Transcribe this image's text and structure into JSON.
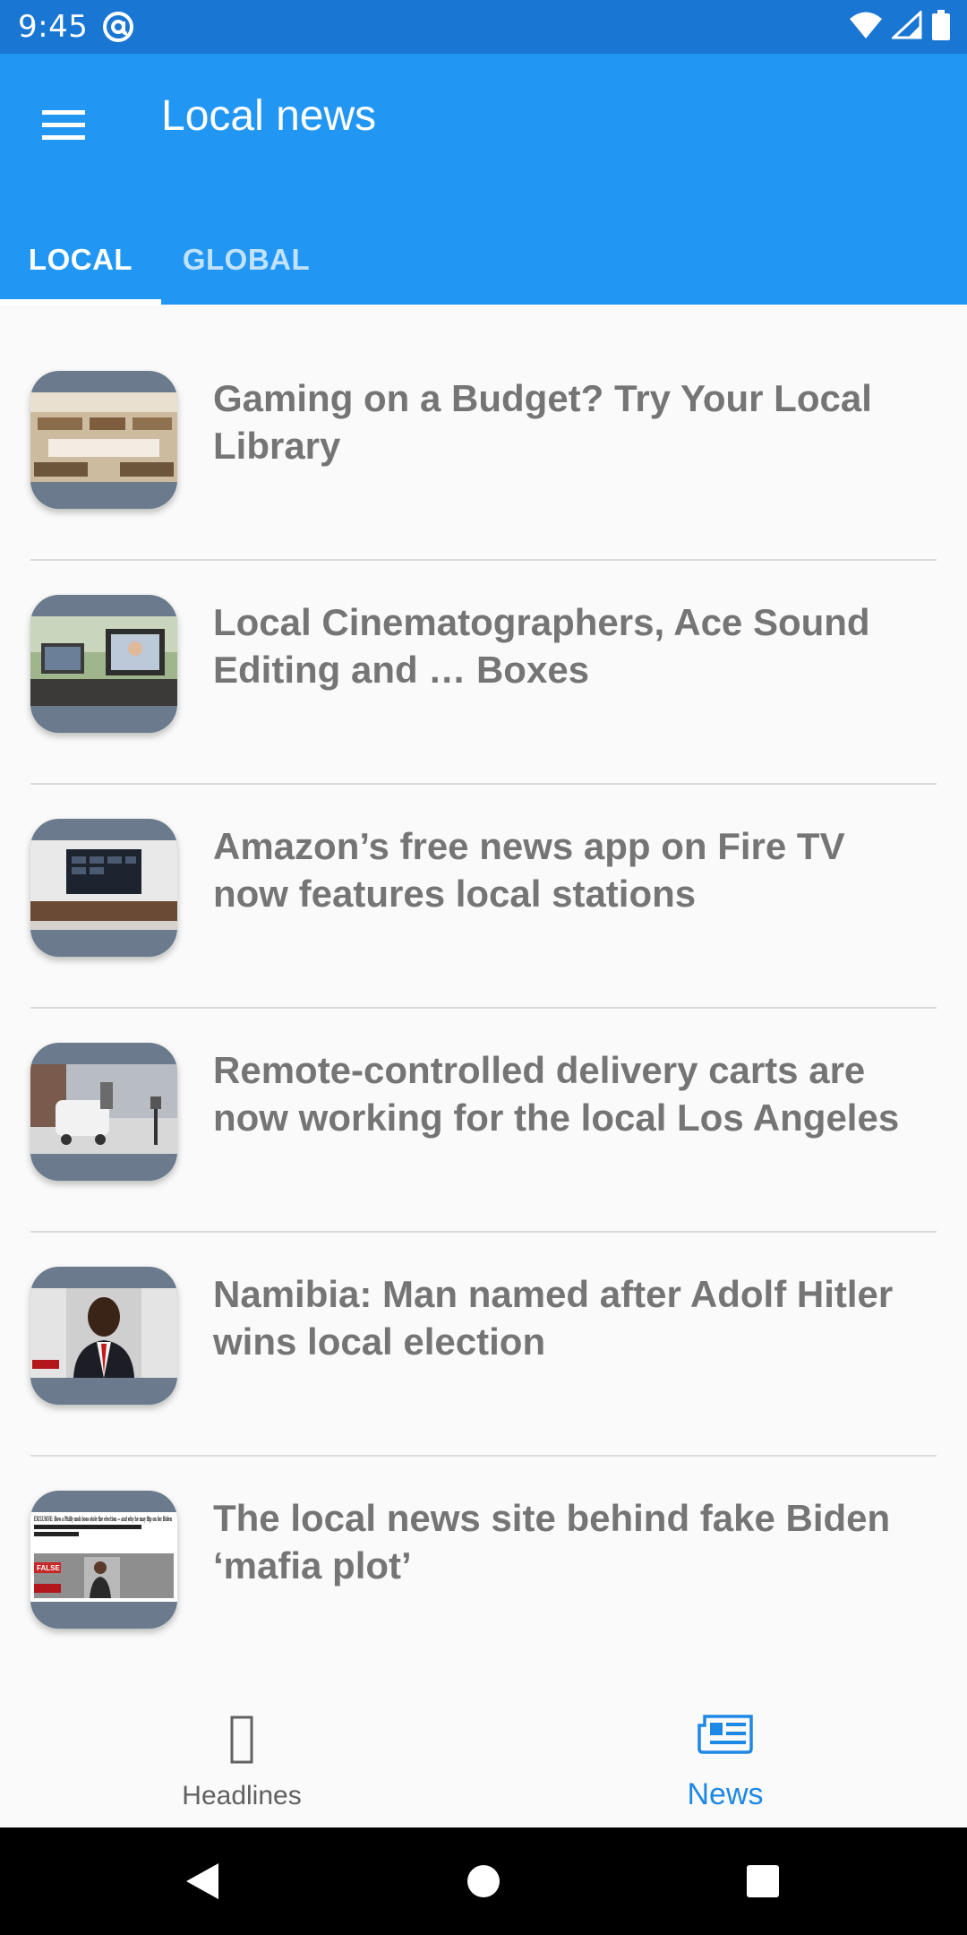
{
  "status_bar": {
    "time": "9:45",
    "icons": [
      "at-sign-icon",
      "wifi-icon",
      "signal-icon",
      "battery-icon"
    ]
  },
  "app_bar": {
    "title": "Local news",
    "menu_icon": "hamburger-menu-icon",
    "color": "#2196F3"
  },
  "tabs": [
    {
      "label": "LOCAL",
      "selected": true
    },
    {
      "label": "GLOBAL",
      "selected": false
    }
  ],
  "news": [
    {
      "title": "Gaming on a Budget? Try Your Local Library",
      "thumb": "library-interior"
    },
    {
      "title": "Local Cinematographers, Ace Sound Editing and … Boxes",
      "thumb": "laptops-outdoors"
    },
    {
      "title": "Amazon’s free news app on Fire TV now features local stations",
      "thumb": "tv-on-console"
    },
    {
      "title": "Remote-controlled delivery carts are now working for the local Los Angeles",
      "thumb": "delivery-cart-street"
    },
    {
      "title": "Namibia: Man named after Adolf Hitler wins local election",
      "thumb": "man-portrait-news"
    },
    {
      "title": "The local news site behind fake Biden ‘mafia plot’",
      "thumb": "news-article-screenshot"
    }
  ],
  "thumb_overlay_texts": {
    "news_5_headline": "EXCLUSIVE: How a Philly mob boss stole the election — and why he may flip on for Biden",
    "news_5_badge": "FALSE"
  },
  "bottom_nav": [
    {
      "label": "Headlines",
      "icon": "headlines-icon",
      "selected": false
    },
    {
      "label": "News",
      "icon": "newspaper-icon",
      "selected": true
    }
  ],
  "accent_color": "#1E88E5",
  "system_nav": [
    "back-icon",
    "home-icon",
    "recents-icon"
  ]
}
